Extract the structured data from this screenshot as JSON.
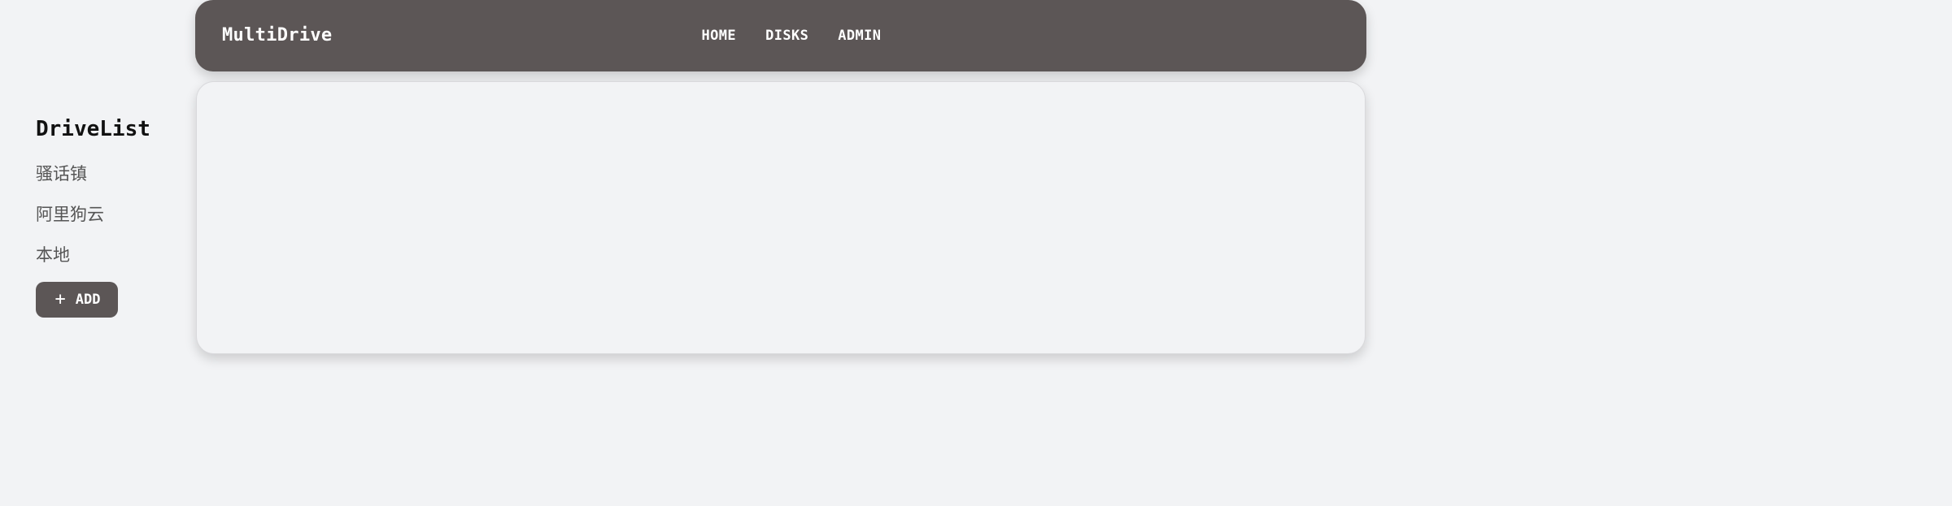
{
  "navbar": {
    "brand": "MultiDrive",
    "links": [
      {
        "label": "HOME"
      },
      {
        "label": "DISKS"
      },
      {
        "label": "ADMIN"
      }
    ]
  },
  "drive_list": {
    "title": "DriveList",
    "items": [
      {
        "label": "骚话镇"
      },
      {
        "label": "阿里狗云"
      },
      {
        "label": "本地"
      }
    ],
    "add_button": {
      "icon": "plus-icon",
      "label": "ADD"
    }
  },
  "colors": {
    "page_background": "#f2f3f5",
    "navbar_background": "#5c5656",
    "button_background": "#5c5656",
    "text_dark": "#111111",
    "text_muted": "#555555"
  }
}
